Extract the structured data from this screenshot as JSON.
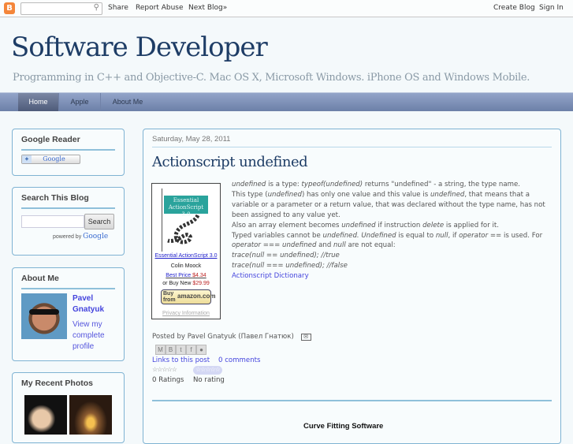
{
  "navbar": {
    "share": "Share",
    "report_abuse": "Report Abuse",
    "next_blog": "Next Blog»",
    "create_blog": "Create Blog",
    "sign_in": "Sign In",
    "search_value": ""
  },
  "header": {
    "title": "Software Developer",
    "description": "Programming in C++ and Objective-C. Mac OS X, Microsoft Windows. iPhone OS and Windows Mobile."
  },
  "tabs": [
    {
      "label": "Home"
    },
    {
      "label": "Apple"
    },
    {
      "label": "About Me"
    }
  ],
  "sidebar": {
    "google_reader": {
      "title": "Google Reader",
      "button": "Google"
    },
    "search": {
      "title": "Search This Blog",
      "input_value": "",
      "button": "Search",
      "powered": "powered by",
      "google": "Google"
    },
    "about": {
      "title": "About Me",
      "name": "Pavel Gnatyuk",
      "profile_link": "View my complete profile"
    },
    "photos": {
      "title": "My Recent Photos"
    }
  },
  "post": {
    "date": "Saturday, May 28, 2011",
    "title": "Actionscript undefined",
    "amazon": {
      "book_title": "Essential ActionScript 3.0",
      "cover_text": "Essential ActionScript 3.0",
      "author": "Colin Moock",
      "best_price_label": "Best Price",
      "best_price": "$4.34",
      "buy_new_label": "or Buy New",
      "buy_new_price": "$29.99",
      "buy_button_top": "Buy from",
      "buy_button_brand": "amazon.com",
      "privacy": "Privacy Information"
    },
    "body": {
      "l1a": "undefined",
      "l1b": " is a type: ",
      "l1c": "typeof(undefined)",
      "l1d": " returns \"undefined\" - a string, the type name.",
      "l2a": "This type (",
      "l2b": "undefined",
      "l2c": ") has only one value and this value is ",
      "l2d": "undefined",
      "l2e": ", that means that a variable or a parameter or a return value, that was declared without the type name, has not been assigned to any value yet.",
      "l3a": "Also an array element becomes ",
      "l3b": "undefined",
      "l3c": " if instruction ",
      "l3d": "delete",
      "l3e": " is applied for it.",
      "l4a": "Typed variables cannot be ",
      "l4b": "undefined. Undefined",
      "l4c": " is equal to ",
      "l4d": "null",
      "l4e": ", if ",
      "l4f": "operator ==",
      "l4g": " is used. For ",
      "l4h": "operator === undefined",
      "l4i": " and ",
      "l4j": "null",
      "l4k": " are not equal:",
      "code1": "trace(null == undefined); //true",
      "code2": "trace(null === undefined); //false",
      "link": "Actionscript Dictionary"
    },
    "footer": {
      "posted_by": "Posted by Pavel Gnatyuk (Павел Гнатюк)",
      "links": "Links to this post",
      "comments": "0 comments",
      "ratings_count": "0 Ratings",
      "rating_status": "No rating"
    },
    "next_heading": "Curve Fitting Software"
  },
  "colors": {
    "accent": "#1e3d66",
    "link": "#4444dd",
    "border": "#7fb3d3"
  }
}
